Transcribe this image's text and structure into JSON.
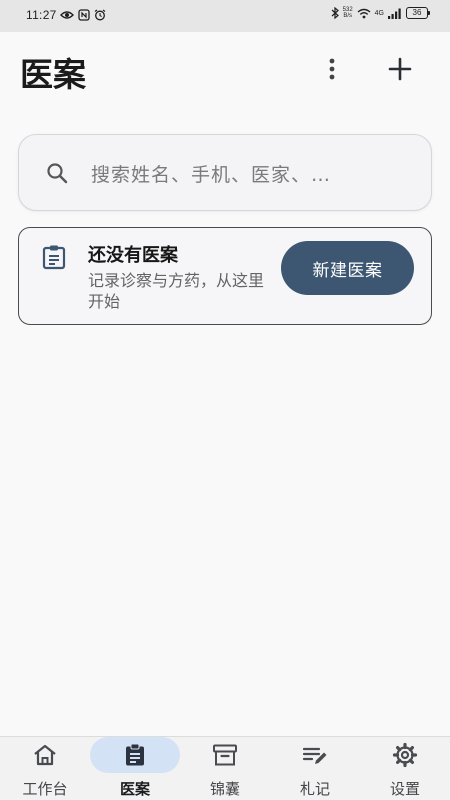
{
  "status_bar": {
    "time": "11:27",
    "net_speed_value": "532",
    "net_speed_unit": "B/s",
    "network": "4G",
    "battery": "36"
  },
  "header": {
    "title": "医案"
  },
  "search": {
    "placeholder": "搜索姓名、手机、医家、…"
  },
  "empty_state": {
    "title": "还没有医案",
    "subtitle": "记录诊察与方药，从这里开始",
    "button_label": "新建医案"
  },
  "bottom_nav": {
    "items": [
      {
        "label": "工作台",
        "icon": "home-icon"
      },
      {
        "label": "医案",
        "icon": "clipboard-icon",
        "active": true
      },
      {
        "label": "锦囊",
        "icon": "archive-box-icon"
      },
      {
        "label": "札记",
        "icon": "notes-edit-icon"
      },
      {
        "label": "设置",
        "icon": "gear-icon"
      }
    ]
  },
  "colors": {
    "primary": "#3d5772",
    "active_nav_pill": "#d3e2f4",
    "background": "#f9f9f9"
  }
}
